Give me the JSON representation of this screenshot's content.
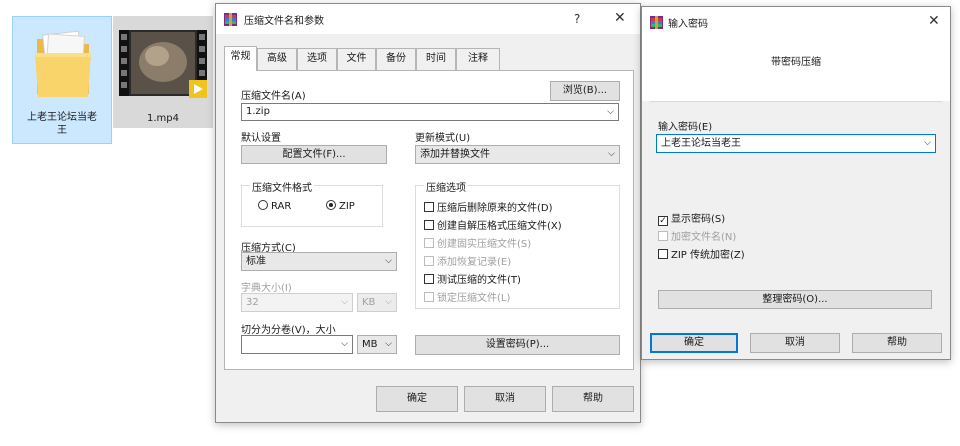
{
  "explorer": {
    "files": [
      {
        "label_line1": "上老王论坛当老",
        "label_line2": "王"
      },
      {
        "label": "1.mp4"
      }
    ]
  },
  "archive_dialog": {
    "title": "压缩文件名和参数",
    "help_glyph": "?",
    "close_glyph": "✕",
    "tabs": [
      "常规",
      "高级",
      "选项",
      "文件",
      "备份",
      "时间",
      "注释"
    ],
    "active_tab": "常规",
    "archive_name_label": "压缩文件名(A)",
    "browse_button": "浏览(B)...",
    "archive_name_value": "1.zip",
    "default_settings_label": "默认设置",
    "profiles_button": "配置文件(F)...",
    "update_mode_label": "更新模式(U)",
    "update_mode_value": "添加并替换文件",
    "format_group_label": "压缩文件格式",
    "format_rar": "RAR",
    "format_zip": "ZIP",
    "selected_format": "ZIP",
    "method_label": "压缩方式(C)",
    "method_value": "标准",
    "dict_label": "字典大小(I)",
    "dict_value": "32",
    "dict_unit": "KB",
    "split_label": "切分为分卷(V)，大小",
    "split_value": "",
    "split_unit": "MB",
    "options_group_label": "压缩选项",
    "options": [
      {
        "label": "压缩后删除原来的文件(D)",
        "checked": false,
        "enabled": true
      },
      {
        "label": "创建自解压格式压缩文件(X)",
        "checked": false,
        "enabled": true
      },
      {
        "label": "创建固实压缩文件(S)",
        "checked": false,
        "enabled": false
      },
      {
        "label": "添加恢复记录(E)",
        "checked": false,
        "enabled": false
      },
      {
        "label": "测试压缩的文件(T)",
        "checked": false,
        "enabled": true
      },
      {
        "label": "锁定压缩文件(L)",
        "checked": false,
        "enabled": false
      }
    ],
    "set_password_button": "设置密码(P)...",
    "ok_button": "确定",
    "cancel_button": "取消",
    "help_button": "帮助"
  },
  "password_dialog": {
    "title": "输入密码",
    "close_glyph": "✕",
    "heading": "带密码压缩",
    "password_label": "输入密码(E)",
    "password_value": "上老王论坛当老王",
    "show_password": {
      "label": "显示密码(S)",
      "checked": true,
      "enabled": true
    },
    "encrypt_names": {
      "label": "加密文件名(N)",
      "checked": false,
      "enabled": false
    },
    "zip_legacy": {
      "label": "ZIP 传统加密(Z)",
      "checked": false,
      "enabled": true
    },
    "organize_button": "整理密码(O)...",
    "ok_button": "确定",
    "cancel_button": "取消",
    "help_button": "帮助"
  },
  "colors": {
    "dialog_bg": "#f0f0f0",
    "selection_bg": "#cce8ff",
    "focus_border": "#0078d7"
  }
}
